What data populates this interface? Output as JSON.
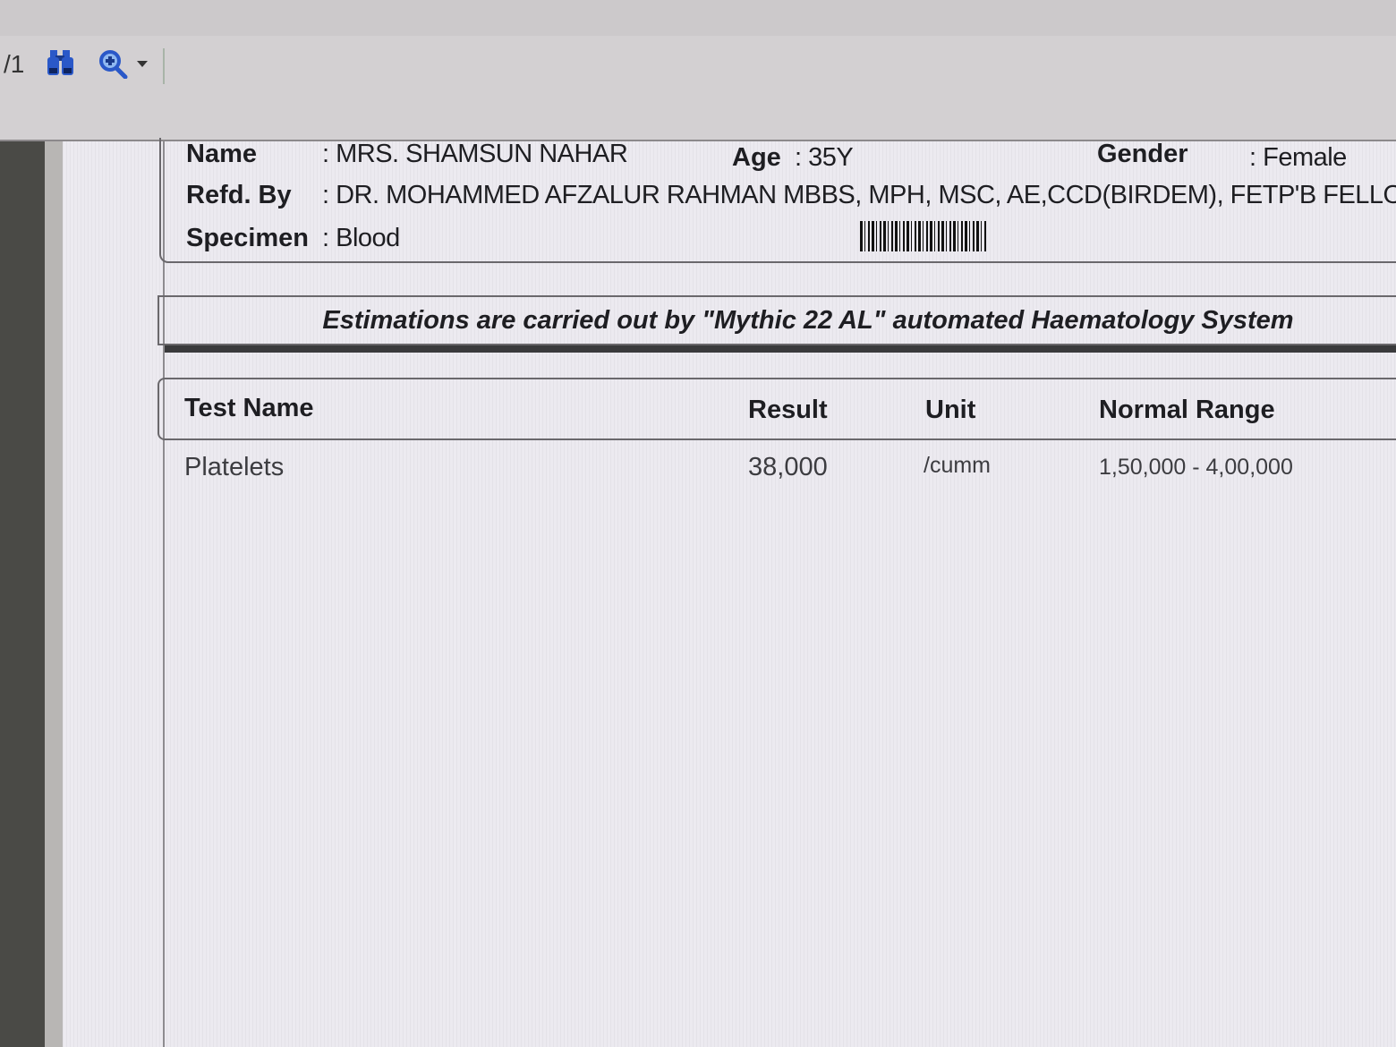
{
  "toolbar": {
    "page_indicator": "/1",
    "icons": [
      "binoculars-icon",
      "zoom-icon",
      "dropdown-arrow-icon"
    ]
  },
  "patient": {
    "name_label": "Name",
    "name_value": ": MRS. SHAMSUN NAHAR",
    "age_label": "Age",
    "age_value": ": 35Y",
    "gender_label": "Gender",
    "gender_value": ": Female",
    "refd_label": "Refd. By",
    "refd_value": ": DR. MOHAMMED AFZALUR RAHMAN MBBS, MPH, MSC, AE,CCD(BIRDEM), FETP'B FELLOW,",
    "specimen_label": "Specimen",
    "specimen_value": ": Blood"
  },
  "notice": "Estimations are carried out by \"Mythic 22 AL\" automated Haematology System",
  "table": {
    "headers": {
      "test_name": "Test Name",
      "result": "Result",
      "unit": "Unit",
      "normal_range": "Normal Range"
    },
    "rows": [
      {
        "test_name": "Platelets",
        "result": "38,000",
        "unit": "/cumm",
        "normal_range": "1,50,000 - 4,00,000"
      }
    ]
  },
  "colors": {
    "page_bg": "#eceaf0",
    "toolbar_bg": "#d3d0d2",
    "left_panel": "#4a4a46",
    "text": "#1e1e22",
    "icon_blue": "#2a58c8"
  }
}
